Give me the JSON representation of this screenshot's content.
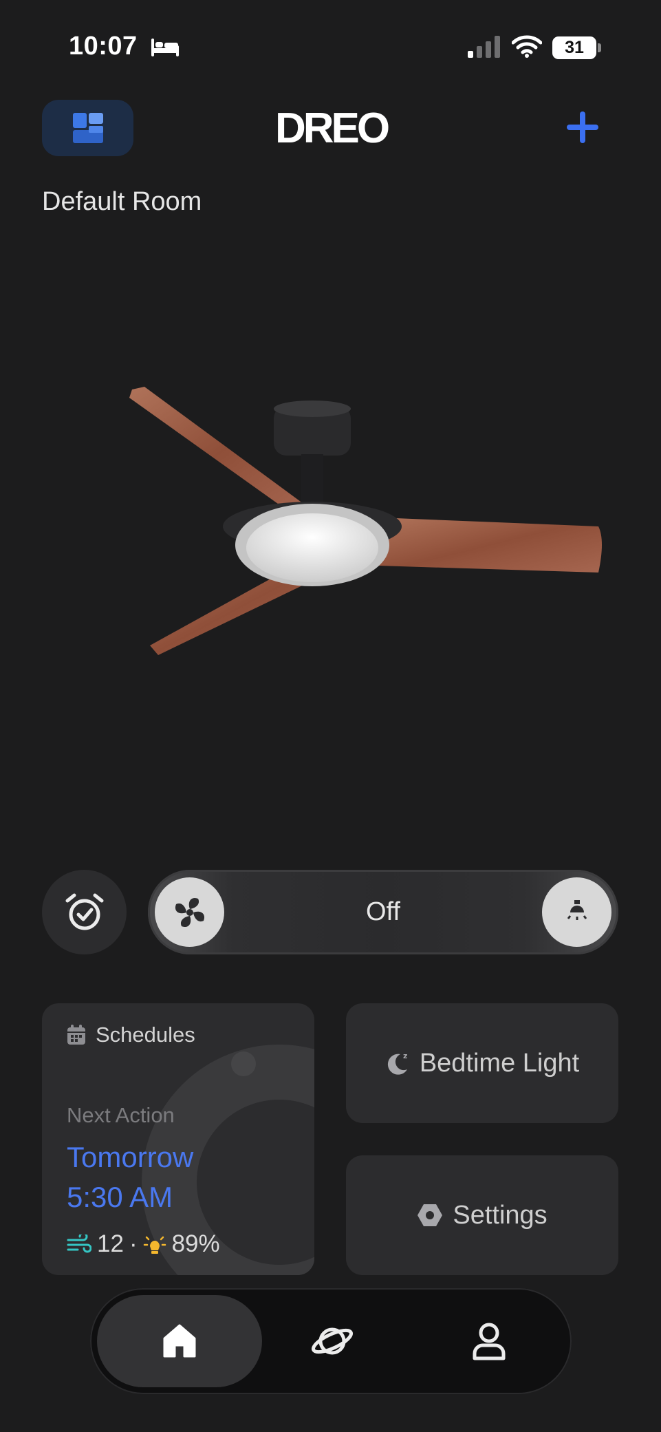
{
  "status_bar": {
    "time": "10:07",
    "battery": "31"
  },
  "header": {
    "logo": "DREO",
    "icons": {
      "rooms": "rooms-grid-icon",
      "add": "plus-icon"
    },
    "accent_color": "#3b6ff0"
  },
  "room": {
    "name": "Default Room"
  },
  "device": {
    "image": "ceiling-fan-with-light"
  },
  "controls": {
    "power_status": "Off",
    "icons": {
      "schedule": "alarm-clock-icon",
      "fan": "fan-icon",
      "light": "bulb-icon"
    }
  },
  "schedules_card": {
    "title": "Schedules",
    "next_action_label": "Next Action",
    "next_day": "Tomorrow",
    "next_time": "5:30 AM",
    "fan_speed": "12",
    "separator": "·",
    "brightness": "89%",
    "colors": {
      "highlight": "#4a78ef",
      "wind": "#35c6c4",
      "sun": "#f5b82e"
    }
  },
  "bedtime_card": {
    "label": "Bedtime Light",
    "icon": "moon-sleep-icon"
  },
  "settings_card": {
    "label": "Settings",
    "icon": "hexagon-settings-icon"
  },
  "bottom_nav": {
    "active": "home",
    "tabs": [
      {
        "id": "home",
        "icon": "home-icon"
      },
      {
        "id": "explore",
        "icon": "planet-icon"
      },
      {
        "id": "profile",
        "icon": "user-icon"
      }
    ]
  }
}
